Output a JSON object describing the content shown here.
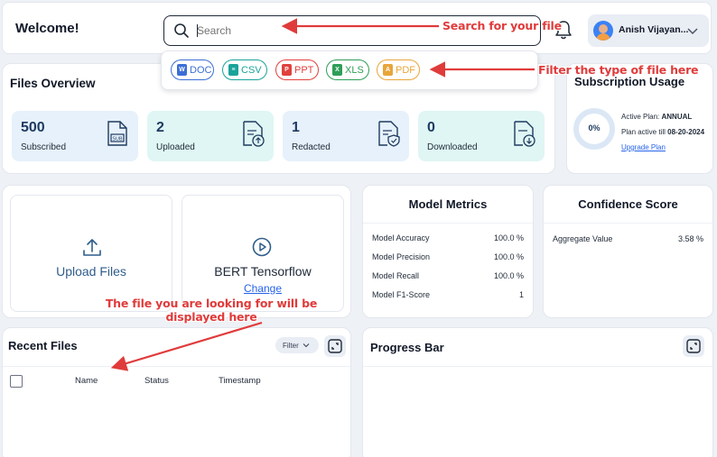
{
  "header": {
    "welcome": "Welcome!",
    "search_placeholder": "Search",
    "user_name": "Anish Vijayan..."
  },
  "filters": {
    "chips": [
      {
        "label": "DOC",
        "color": "#3b6fd6"
      },
      {
        "label": "CSV",
        "color": "#1aa39a"
      },
      {
        "label": "PPT",
        "color": "#e0413d"
      },
      {
        "label": "XLS",
        "color": "#2e9e58"
      },
      {
        "label": "PDF",
        "color": "#e8a53a"
      }
    ]
  },
  "annotations": {
    "search": "Search for your file",
    "filter": "Filter the type of file here",
    "display": "The file you are looking for will be displayed here"
  },
  "files_overview": {
    "title": "Files Overview",
    "stats": [
      {
        "value": "500",
        "label": "Subscribed",
        "icon": "sub-document-icon",
        "bg": "#e6f1fb"
      },
      {
        "value": "2",
        "label": "Uploaded",
        "icon": "upload-document-icon",
        "bg": "#dff6f4"
      },
      {
        "value": "1",
        "label": "Redacted",
        "icon": "redacted-document-icon",
        "bg": "#e6f1fb"
      },
      {
        "value": "0",
        "label": "Downloaded",
        "icon": "download-document-icon",
        "bg": "#dff6f4"
      }
    ]
  },
  "subscription": {
    "title": "Subscription Usage",
    "percent": "0%",
    "active_plan_label": "Active Plan:",
    "active_plan_value": "ANNUAL",
    "active_till_label": "Plan active till",
    "active_till_value": "08-20-2024",
    "upgrade": "Upgrade Plan"
  },
  "upload": {
    "label": "Upload Files"
  },
  "model": {
    "name": "BERT Tensorflow",
    "change": "Change"
  },
  "model_metrics": {
    "title": "Model Metrics",
    "rows": [
      {
        "name": "Model Accuracy",
        "value": "100.0 %"
      },
      {
        "name": "Model Precision",
        "value": "100.0 %"
      },
      {
        "name": "Model Recall",
        "value": "100.0 %"
      },
      {
        "name": "Model F1-Score",
        "value": "1"
      }
    ]
  },
  "confidence": {
    "title": "Confidence Score",
    "label": "Aggregate Value",
    "value": "3.58 %"
  },
  "recent_files": {
    "title": "Recent Files",
    "filter": "Filter",
    "columns": [
      "Name",
      "Status",
      "Timestamp"
    ]
  },
  "progress": {
    "title": "Progress Bar"
  }
}
